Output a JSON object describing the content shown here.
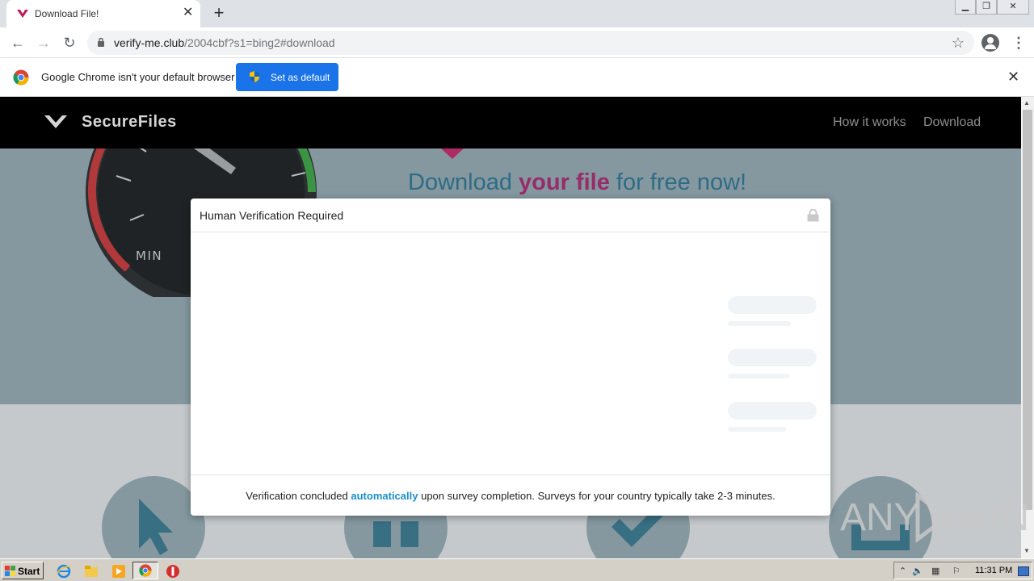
{
  "browser": {
    "tab_title": "Download File!",
    "url_host": "verify-me.club",
    "url_rest": "/2004cbf?s1=bing2#download"
  },
  "infobar": {
    "message": "Google Chrome isn't your default browser",
    "button_label": "Set as default"
  },
  "site": {
    "brand": "SecureFiles",
    "nav_links": [
      "How it works",
      "Download"
    ],
    "gauge_label": "MIN",
    "headline_a": "Download ",
    "headline_b": "your file",
    "headline_c": " for free now!"
  },
  "modal": {
    "title": "Human Verification Required",
    "footer_a": "Verification concluded ",
    "footer_b": "automatically",
    "footer_c": " upon survey completion. Surveys for your country typically take 2-3 minutes."
  },
  "watermark": {
    "left": "ANY",
    "right": "RUN"
  },
  "taskbar": {
    "start_label": "Start",
    "clock": "11:31 PM"
  },
  "colors": {
    "accent": "#1a73e8",
    "brand_pink": "#a51866",
    "headline_blue": "#1d6a86",
    "link_blue": "#1a8fc9"
  }
}
